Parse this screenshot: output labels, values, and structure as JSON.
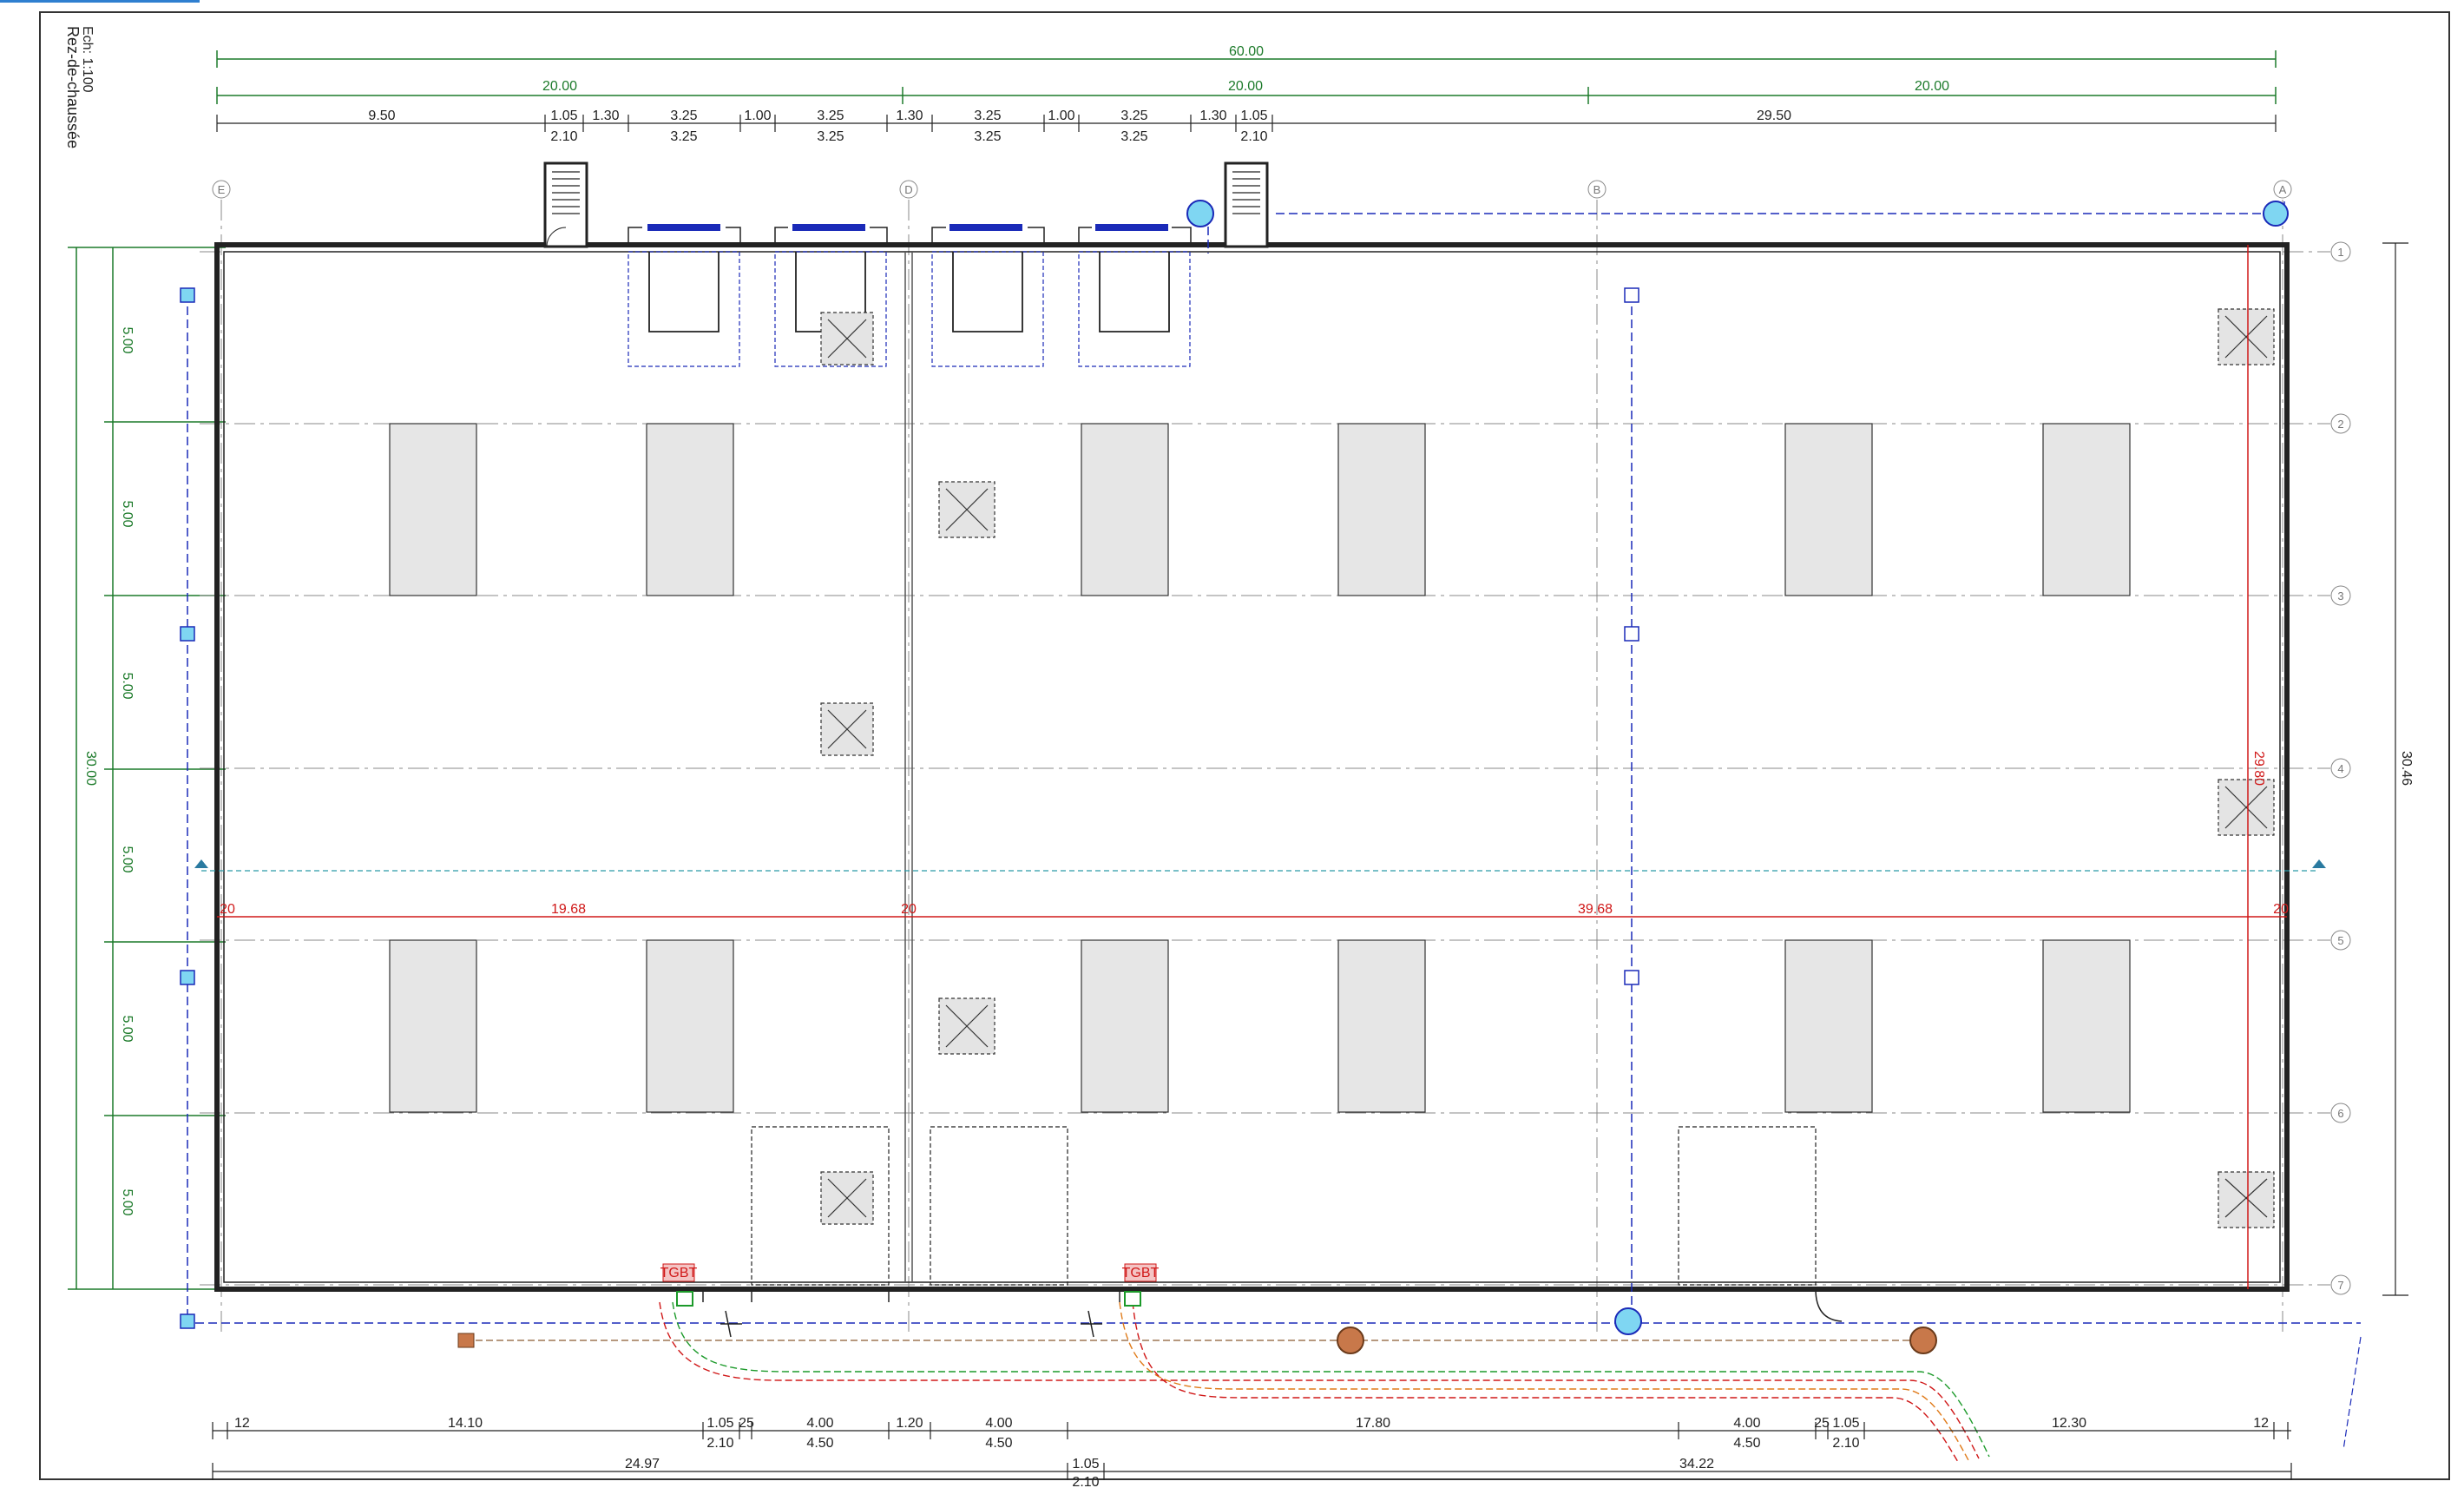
{
  "drawing": {
    "title": "Rez-de-chaussée",
    "scale": "Ech: 1:100",
    "colors": {
      "dimension_green": "#1c7a2a",
      "dimension_red": "#d01818",
      "network_blue": "#1a2ab8",
      "skylight_fill": "#e6e6e6",
      "equipment_cyan": "#7fd6f2",
      "equipment_brown": "#c8784a",
      "accent_top": "#2f7fd0"
    }
  },
  "top_dims": {
    "overall": "60.00",
    "thirds": [
      "20.00",
      "20.00",
      "20.00"
    ],
    "segments": [
      "9.50",
      "1.05",
      "1.30",
      "3.25",
      "1.00",
      "3.25",
      "1.30",
      "3.25",
      "1.00",
      "3.25",
      "1.30",
      "1.05",
      "29.50"
    ],
    "sub_segments": [
      "2.10",
      "3.25",
      "3.25",
      "3.25",
      "3.25",
      "2.10"
    ]
  },
  "left_dims": {
    "bays": [
      "5.00",
      "5.00",
      "5.00",
      "5.00",
      "5.00",
      "5.00"
    ],
    "overall": "30.00"
  },
  "right_dims": {
    "overall": "30.46",
    "red_vertical": "29.80"
  },
  "red_section": {
    "left_end": "20",
    "left_value": "19.68",
    "mid_end": "20",
    "right_value": "39.68",
    "right_end": "20"
  },
  "bottom_dims": {
    "row1": [
      "12",
      "14.10",
      "1.05",
      "25",
      "4.00",
      "1.20",
      "4.00",
      "17.80",
      "4.00",
      "25",
      "1.05",
      "12.30",
      "12"
    ],
    "row1b": [
      "2.10",
      "4.50",
      "4.50",
      "4.50",
      "2.10"
    ],
    "row2": [
      "24.97",
      "1.05",
      "34.22"
    ],
    "row2b": [
      "2.10"
    ]
  },
  "grid": {
    "top_letters": [
      "E",
      "D",
      "B",
      "A"
    ],
    "right_numbers": [
      "1",
      "2",
      "3",
      "4",
      "5",
      "6",
      "7"
    ]
  },
  "tags": {
    "tgbt": "TGBT"
  }
}
